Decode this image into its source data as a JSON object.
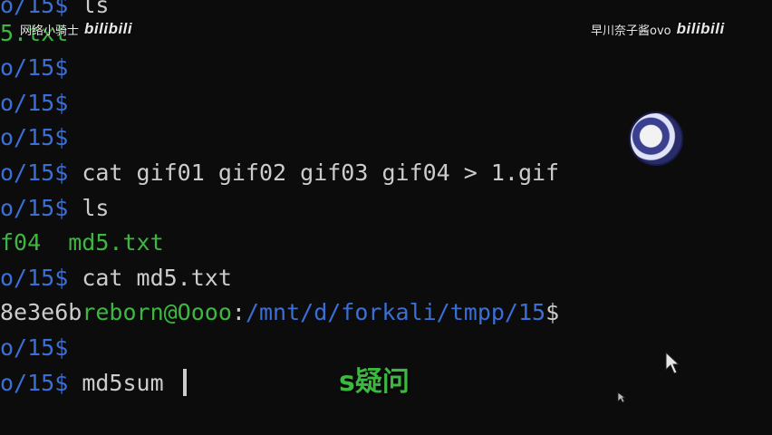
{
  "watermarks": {
    "left_text": "网络小骑士",
    "left_logo": "bilibili",
    "right_text": "早川奈子酱ovo",
    "right_logo": "bilibili"
  },
  "terminal": {
    "line0": {
      "prompt": "o/15$",
      "cmd": " ls"
    },
    "line1": {
      "output": "5.txt"
    },
    "line2": {
      "prompt": "o/15$",
      "cmd": ""
    },
    "line3": {
      "prompt": "o/15$",
      "cmd": ""
    },
    "line4": {
      "prompt": "o/15$",
      "cmd": ""
    },
    "line5": {
      "prompt": "o/15$",
      "cmd": " cat gif01 gif02 gif03 gif04 > 1.gif"
    },
    "line6": {
      "prompt": "o/15$",
      "cmd": " ls"
    },
    "line7": {
      "output": "f04  md5.txt"
    },
    "line8": {
      "prompt": "o/15$",
      "cmd": " cat md5.txt"
    },
    "line9": {
      "hash": "8e3e6b",
      "userhost": "reborn@Oooo",
      "sep": ":",
      "path": "/mnt/d/forkali/tmpp/15",
      "dollar": "$"
    },
    "line10": {
      "prompt": "o/15$",
      "cmd": ""
    },
    "line11": {
      "prompt": "o/15$",
      "cmd": " md5sum "
    }
  },
  "subtitle": "s疑问",
  "colors": {
    "background": "#0c0c0c",
    "prompt_blue": "#3b6fd6",
    "output_green": "#3cb841",
    "text": "#cccccc"
  }
}
